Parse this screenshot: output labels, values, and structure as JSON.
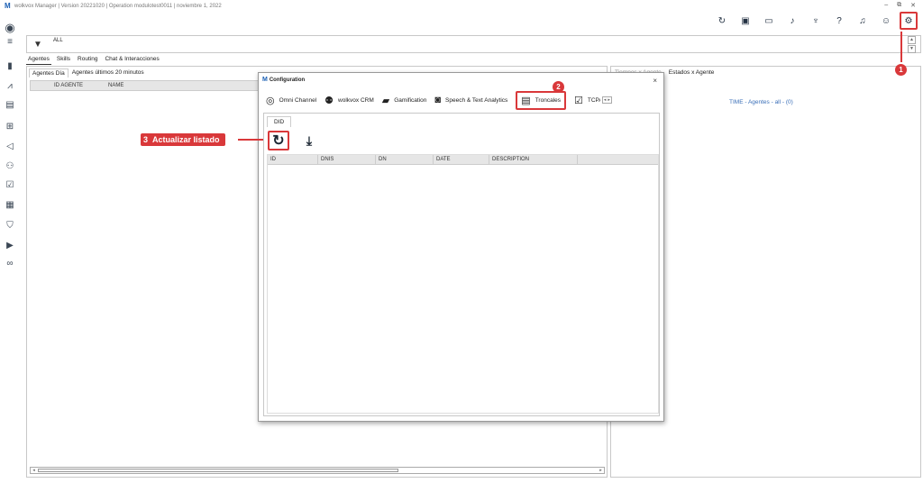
{
  "titlebar": {
    "app_title": "wolkvox Manager | Version 20221020 | Operation modulotest0011 | noviembre 1, 2022",
    "logo": "M",
    "controls": [
      "–",
      "⧉",
      "✕"
    ]
  },
  "sidebar": {
    "icons": [
      "user-circle-icon",
      "hamburger-menu-icon",
      "bar-chart-icon",
      "line-chart-icon",
      "document-icon",
      "org-chart-icon",
      "campaign-icon",
      "users-icon",
      "checklist-icon",
      "report-icon",
      "shield-icon",
      "video-icon",
      "voicemail-icon"
    ]
  },
  "toolbar": {
    "icons": [
      "refresh-icon",
      "gallery-icon",
      "contact-card-icon",
      "music-icon",
      "microphone-icon",
      "help-icon",
      "bell-icon",
      "user-icon",
      "settings-icon"
    ]
  },
  "filter": {
    "value": "ALL"
  },
  "main_tabs": [
    "Agentes",
    "Skills",
    "Routing",
    "Chat & Interacciones"
  ],
  "left_panel": {
    "subtabs": [
      "Agentes Día",
      "Agentes últimos 20 minutos"
    ],
    "grid_columns": [
      "ID AGENTE",
      "NAME"
    ]
  },
  "right_panel": {
    "tabs": [
      "Tiempos x Agente",
      "Estados x Agente"
    ],
    "summary": "TIME - Agentes - all - (0)"
  },
  "dialog": {
    "title": "Configuration",
    "close": "×",
    "modules": [
      {
        "label": "Omni Channel",
        "icon": "omni-channel-icon"
      },
      {
        "label": "wolkvox CRM",
        "icon": "crm-icon"
      },
      {
        "label": "Gamification",
        "icon": "gamification-icon"
      },
      {
        "label": "Speech & Text Analytics",
        "icon": "speech-analytics-icon"
      },
      {
        "label": "Troncales",
        "icon": "trunks-icon"
      },
      {
        "label": "TCPA-C",
        "icon": "tcpa-icon"
      }
    ],
    "tab": "DID",
    "grid_columns": [
      "ID",
      "DNIS",
      "DN",
      "DATE",
      "DESCRIPTION"
    ]
  },
  "annotations": {
    "step1": "1",
    "step2": "2",
    "step3_num": "3",
    "step3_label": "Actualizar listado"
  },
  "colors": {
    "accent_red": "#d9383a",
    "link_blue": "#3a6fb8"
  }
}
